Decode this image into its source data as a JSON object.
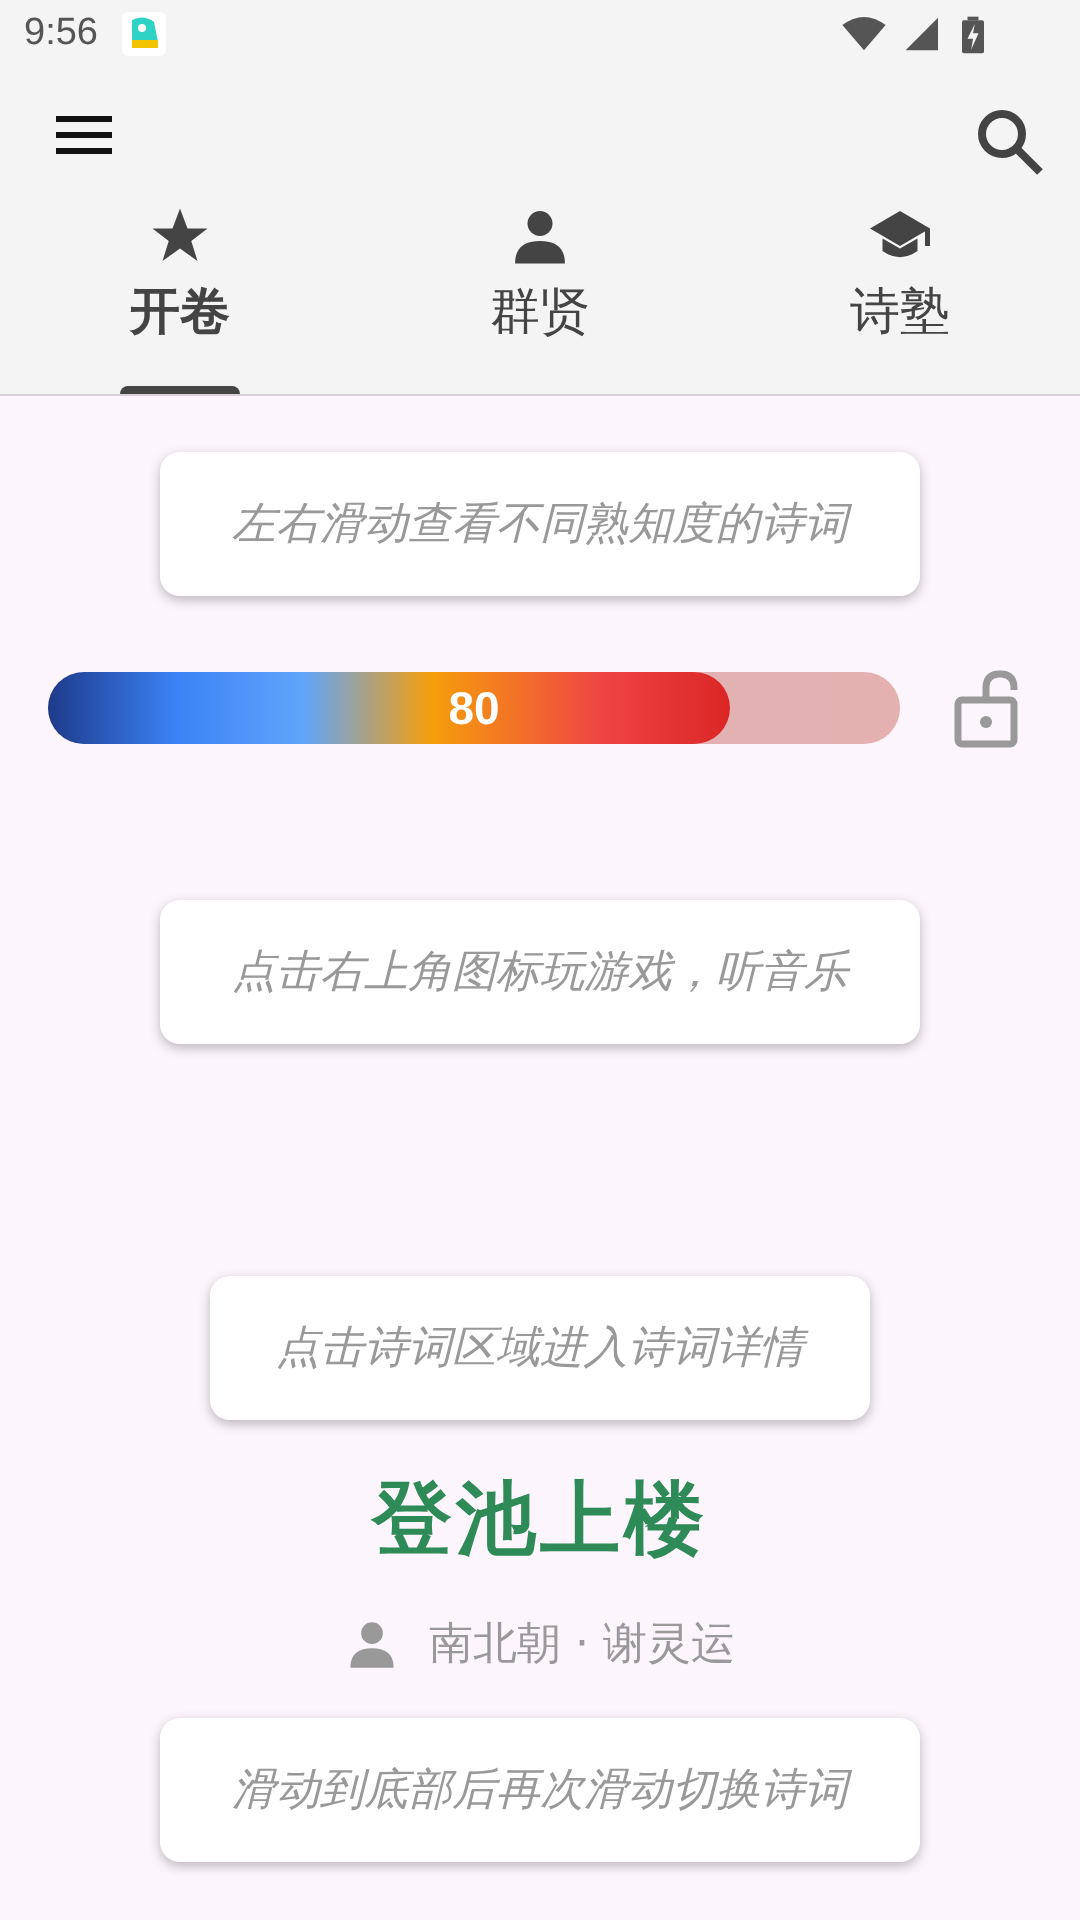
{
  "status_bar": {
    "time": "9:56"
  },
  "tabs": [
    {
      "label": "开卷",
      "kind": "featured",
      "selected": true
    },
    {
      "label": "群贤",
      "kind": "poets",
      "selected": false
    },
    {
      "label": "诗塾",
      "kind": "study",
      "selected": false
    }
  ],
  "tips": [
    "左右滑动查看不同熟知度的诗词",
    "点击右上角图标玩游戏，听音乐",
    "点击诗词区域进入诗词详情",
    "滑动到底部后再次滑动切换诗词"
  ],
  "slider": {
    "level": 0.8,
    "reading": "80",
    "locked": false
  },
  "poem": {
    "title": "登池上楼",
    "author": "南北朝 · 谢灵运"
  }
}
